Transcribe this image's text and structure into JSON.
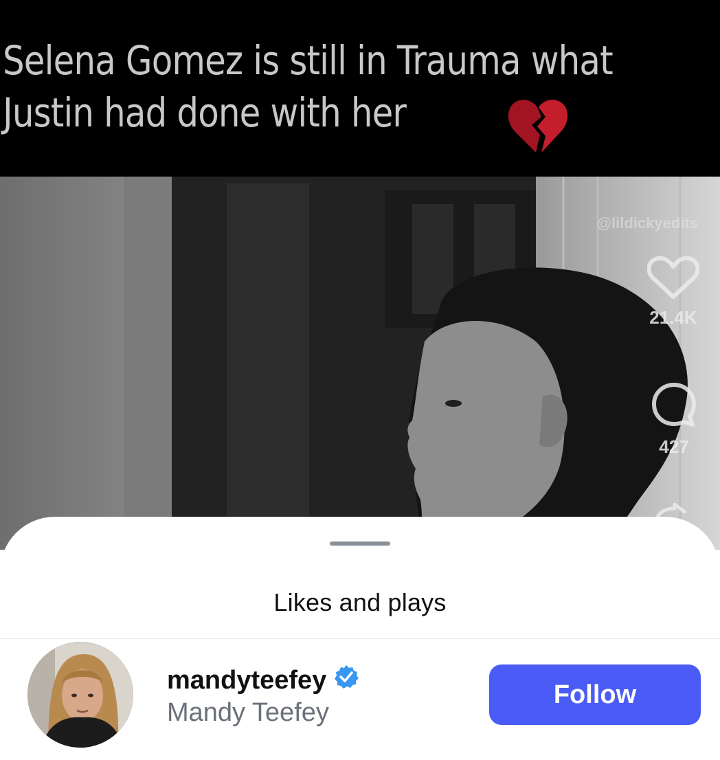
{
  "video": {
    "caption": "Selena Gomez is still in Trauma what Justin had done with her",
    "caption_emoji": "broken-heart-icon",
    "watermark": "@lildickyedits",
    "like_count": "21.4K",
    "comment_count": "427"
  },
  "sheet": {
    "title": "Likes and plays",
    "users": [
      {
        "username": "mandyteefey",
        "full_name": "Mandy Teefey",
        "verified": true,
        "follow_label": "Follow"
      }
    ]
  },
  "colors": {
    "follow_button": "#4a5cf5",
    "verified_badge": "#3897f0",
    "caption_text": "#c8c8c8"
  }
}
